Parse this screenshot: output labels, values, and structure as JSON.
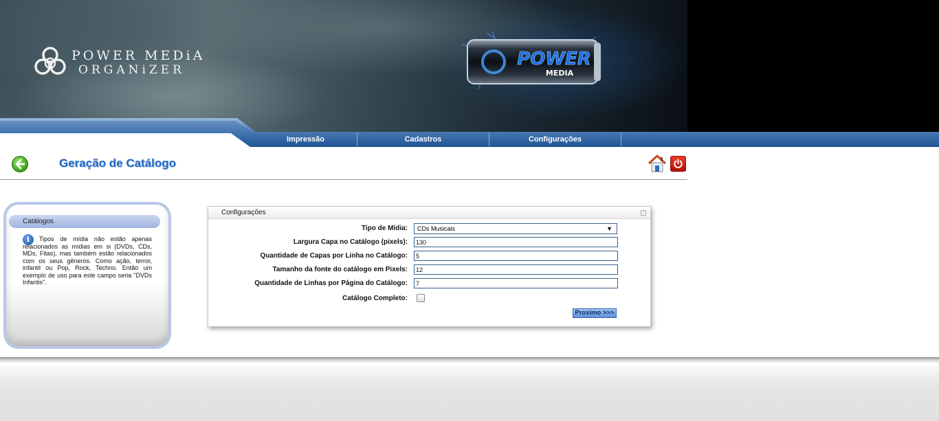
{
  "header": {
    "logo_line1": "POWER MEDiA",
    "logo_line2": "ORGANiZER",
    "can_brand": "POWER",
    "can_sub": "MEDIA"
  },
  "nav": {
    "items": [
      "Impressão",
      "Cadastros",
      "Configurações"
    ]
  },
  "page": {
    "title": "Geração de Catálogo"
  },
  "sidebar": {
    "header": "Catálogos",
    "info_text": "Tipos de mídia não estão apenas relacionados as mídias em si (DVDs, CDs, MDs, Fitas), mas também estão relacionados com os seus gêneros. Como ação, terror, infantil ou Pop, Rock, Techno. Então um exemplo de uso para este campo seria \"DVDs Infantis\"."
  },
  "form": {
    "panel_title": "Configurações",
    "media_type_label": "Tipo de Mídia:",
    "media_type_value": "CDs Musicais",
    "cover_width_label": "Largura Capa no Catálogo (pixels):",
    "cover_width_value": "130",
    "covers_per_line_label": "Quantidade de Capas por Linha no Catálogo:",
    "covers_per_line_value": "5",
    "font_size_label": "Tamanho da fonte do catálogo em Pixels:",
    "font_size_value": "12",
    "lines_per_page_label": "Quantidade de Linhas por Página do Catálogo:",
    "lines_per_page_value": "7",
    "full_catalog_label": "Catálogo Completo:",
    "next_button": "Proximo >>>"
  }
}
